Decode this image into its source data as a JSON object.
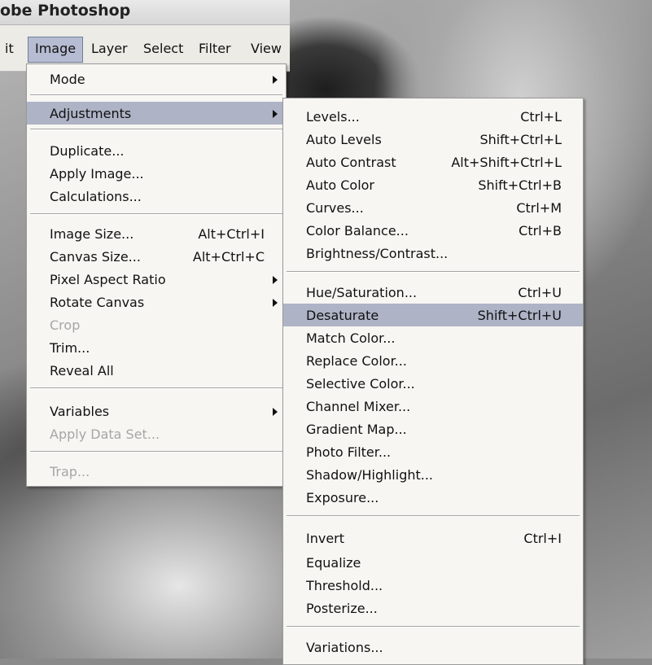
{
  "app": {
    "title": "obe Photoshop"
  },
  "menubar": {
    "items": [
      {
        "label": "it"
      },
      {
        "label": "Image"
      },
      {
        "label": "Layer"
      },
      {
        "label": "Select"
      },
      {
        "label": "Filter"
      },
      {
        "label": "View"
      }
    ]
  },
  "image_menu": {
    "items": [
      {
        "label": "Mode"
      },
      {
        "label": "Adjustments"
      },
      {
        "label": "Duplicate..."
      },
      {
        "label": "Apply Image..."
      },
      {
        "label": "Calculations..."
      },
      {
        "label": "Image Size...",
        "shortcut": "Alt+Ctrl+I"
      },
      {
        "label": "Canvas Size...",
        "shortcut": "Alt+Ctrl+C"
      },
      {
        "label": "Pixel Aspect Ratio"
      },
      {
        "label": "Rotate Canvas"
      },
      {
        "label": "Crop"
      },
      {
        "label": "Trim..."
      },
      {
        "label": "Reveal All"
      },
      {
        "label": "Variables"
      },
      {
        "label": "Apply Data Set..."
      },
      {
        "label": "Trap..."
      }
    ]
  },
  "adjustments_menu": {
    "items": [
      {
        "label": "Levels...",
        "shortcut": "Ctrl+L"
      },
      {
        "label": "Auto Levels",
        "shortcut": "Shift+Ctrl+L"
      },
      {
        "label": "Auto Contrast",
        "shortcut": "Alt+Shift+Ctrl+L"
      },
      {
        "label": "Auto Color",
        "shortcut": "Shift+Ctrl+B"
      },
      {
        "label": "Curves...",
        "shortcut": "Ctrl+M"
      },
      {
        "label": "Color Balance...",
        "shortcut": "Ctrl+B"
      },
      {
        "label": "Brightness/Contrast..."
      },
      {
        "label": "Hue/Saturation...",
        "shortcut": "Ctrl+U"
      },
      {
        "label": "Desaturate",
        "shortcut": "Shift+Ctrl+U"
      },
      {
        "label": "Match Color..."
      },
      {
        "label": "Replace Color..."
      },
      {
        "label": "Selective Color..."
      },
      {
        "label": "Channel Mixer..."
      },
      {
        "label": "Gradient Map..."
      },
      {
        "label": "Photo Filter..."
      },
      {
        "label": "Shadow/Highlight..."
      },
      {
        "label": "Exposure..."
      },
      {
        "label": "Invert",
        "shortcut": "Ctrl+I"
      },
      {
        "label": "Equalize"
      },
      {
        "label": "Threshold..."
      },
      {
        "label": "Posterize..."
      },
      {
        "label": "Variations..."
      }
    ]
  },
  "colors": {
    "highlight": "#aeb3c6",
    "menu_bg": "#f7f6f2",
    "disabled": "#a6a6a6"
  },
  "icons": {
    "submenu": "submenu-arrow-icon"
  }
}
